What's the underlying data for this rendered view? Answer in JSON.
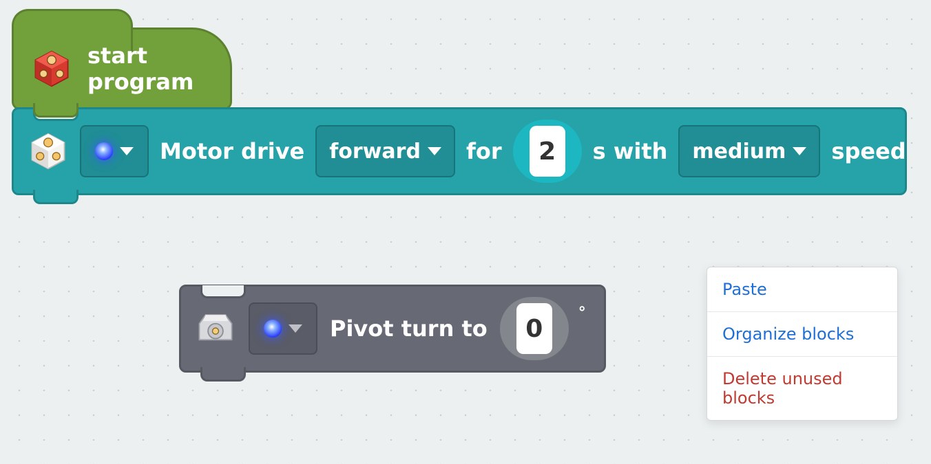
{
  "start_block": {
    "label": "start program"
  },
  "motor_block": {
    "text_1": "Motor drive",
    "direction_options_selected": "forward",
    "text_2": "for",
    "seconds_value": "2",
    "text_3": "s with",
    "speed_options_selected": "medium",
    "text_4": "speed"
  },
  "pivot_block": {
    "text_1": "Pivot turn to",
    "angle_value": "0",
    "degree_symbol": "°"
  },
  "context_menu": {
    "paste": "Paste",
    "organize": "Organize blocks",
    "delete_unused": "Delete unused blocks"
  },
  "colors": {
    "hat": "#72a13b",
    "teal": "#26a3a9",
    "grey_block": "#676975",
    "menu_blue": "#1f6fd6",
    "menu_red": "#c13a31"
  }
}
